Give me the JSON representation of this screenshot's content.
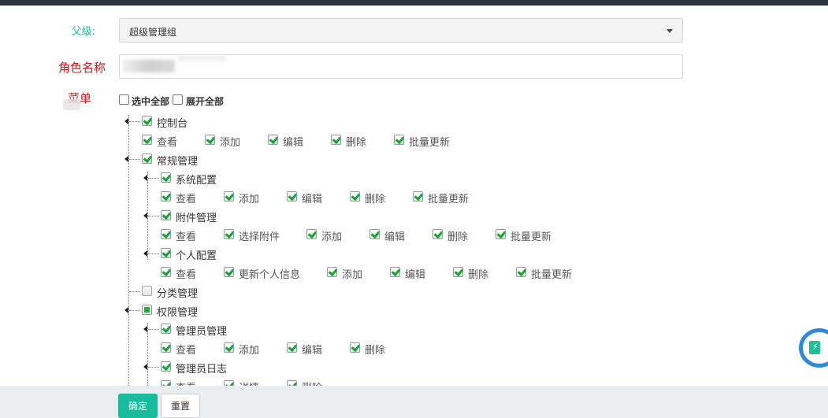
{
  "form": {
    "parent_label": "父级:",
    "parent_value": "超级管理组",
    "role_label": "角色名称",
    "menu_label": "菜单",
    "select_all_label": "选中全部",
    "expand_all_label": "展开全部"
  },
  "tree": {
    "dashboard": {
      "label": "控制台",
      "state": "checked",
      "actions": [
        "查看",
        "添加",
        "编辑",
        "删除",
        "批量更新"
      ]
    },
    "general": {
      "label": "常规管理",
      "state": "checked",
      "system_config": {
        "label": "系统配置",
        "actions": [
          "查看",
          "添加",
          "编辑",
          "删除",
          "批量更新"
        ]
      },
      "attachment": {
        "label": "附件管理",
        "actions": [
          "查看",
          "选择附件",
          "添加",
          "编辑",
          "删除",
          "批量更新"
        ]
      },
      "profile": {
        "label": "个人配置",
        "actions": [
          "查看",
          "更新个人信息",
          "添加",
          "编辑",
          "删除",
          "批量更新"
        ]
      }
    },
    "category": {
      "label": "分类管理",
      "state": "unchecked"
    },
    "auth": {
      "label": "权限管理",
      "state": "partial",
      "admin": {
        "label": "管理员管理",
        "actions": [
          "查看",
          "添加",
          "编辑",
          "删除"
        ]
      },
      "admin_log": {
        "label": "管理员日志",
        "actions": [
          "查看",
          "详情",
          "删除"
        ]
      }
    }
  },
  "buttons": {
    "submit_label": "确定",
    "reset_label": "重置"
  },
  "colors": {
    "primary": "#18bc9c",
    "label_red": "#c81e1e",
    "topbar": "#2c3440",
    "check_green": "#17a52d",
    "badge_blue": "#2d8bd8"
  },
  "float_widget_icon": "lightning-icon"
}
